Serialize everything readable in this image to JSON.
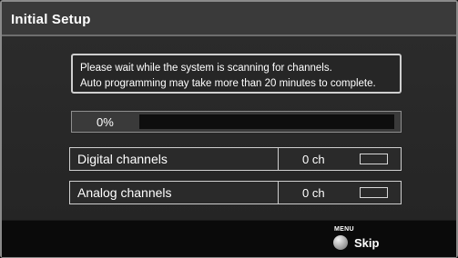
{
  "window": {
    "title": "Initial Setup"
  },
  "message": {
    "line1": "Please wait while the system is scanning for channels.",
    "line2": "Auto programming may take more than 20 minutes to complete."
  },
  "progress": {
    "label": "0%",
    "fraction": 0
  },
  "channels": {
    "digital": {
      "label": "Digital channels",
      "count": "0 ch"
    },
    "analog": {
      "label": "Analog channels",
      "count": "0 ch"
    }
  },
  "footer": {
    "menu_tag": "MENU",
    "skip_label": "Skip",
    "menu_icon": "menu-round-button-icon"
  },
  "colors": {
    "progress_fill": "#6fa0d8",
    "background": "#2a2a2a",
    "border": "#cfcfcf"
  }
}
